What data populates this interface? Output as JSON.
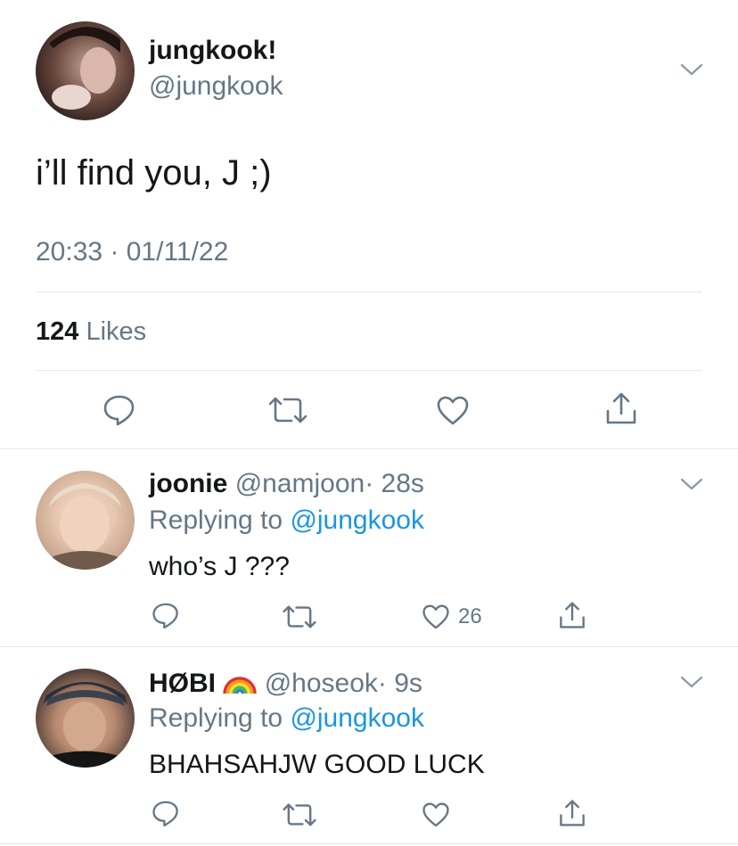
{
  "main_tweet": {
    "display_name": "jungkook!",
    "handle": "@jungkook",
    "text": "i’ll find you, J ;)",
    "timestamp": "20:33 · 01/11/22",
    "likes_count": "124",
    "likes_label": "Likes"
  },
  "replies": [
    {
      "display_name": "joonie",
      "handle": "@namjoon",
      "time": "· 28s",
      "replying_prefix": "Replying to",
      "replying_to": "@jungkook",
      "text": "who’s J ???",
      "like_count": "26"
    },
    {
      "display_name": "HØBI",
      "handle": "@hoseok",
      "time": "· 9s",
      "replying_prefix": "Replying to",
      "replying_to": "@jungkook",
      "text": "BHAHSAHJW GOOD LUCK",
      "like_count": ""
    }
  ],
  "icons": [
    "reply-icon",
    "retweet-icon",
    "like-icon",
    "share-icon",
    "chevron-down-icon",
    "rainbow-emoji"
  ],
  "colors": {
    "text": "#14171a",
    "secondary": "#657786",
    "link": "#1b95e0",
    "divider": "#e1e8ed"
  }
}
